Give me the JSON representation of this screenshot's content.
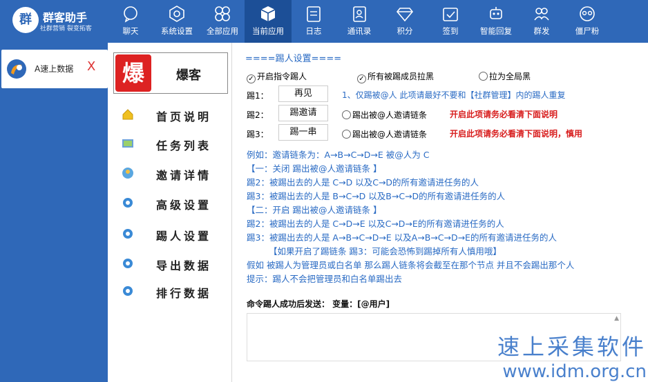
{
  "logo": {
    "title": "群客助手",
    "sub": "社群营销 裂变拓客",
    "badge": "群"
  },
  "nav": [
    {
      "label": "聊天",
      "icon": "chat-icon"
    },
    {
      "label": "系统设置",
      "icon": "gear-hex-icon"
    },
    {
      "label": "全部应用",
      "icon": "grid-apps-icon"
    },
    {
      "label": "当前应用",
      "icon": "cube-icon"
    },
    {
      "label": "日志",
      "icon": "log-icon"
    },
    {
      "label": "通讯录",
      "icon": "contacts-icon"
    },
    {
      "label": "积分",
      "icon": "diamond-icon"
    },
    {
      "label": "签到",
      "icon": "checkin-icon"
    },
    {
      "label": "智能回复",
      "icon": "robot-icon"
    },
    {
      "label": "群发",
      "icon": "group-send-icon"
    },
    {
      "label": "僵尸粉",
      "icon": "zombie-icon"
    }
  ],
  "account": {
    "name": "A速上数据",
    "close": "X"
  },
  "app": {
    "name": "爆客",
    "icon_text": "爆"
  },
  "menu": [
    {
      "label": "首页说明",
      "icon": "home-icon"
    },
    {
      "label": "任务列表",
      "icon": "task-list-icon"
    },
    {
      "label": "邀请详情",
      "icon": "invite-icon"
    },
    {
      "label": "高级设置",
      "icon": "gear-icon"
    },
    {
      "label": "踢人设置",
      "icon": "gear-icon"
    },
    {
      "label": "导出数据",
      "icon": "gear-icon"
    },
    {
      "label": "排行数据",
      "icon": "gear-icon"
    }
  ],
  "content": {
    "section_title": "====踢人设置====",
    "opt1": "开启指令踢人",
    "opt2": "所有被踢成员拉黑",
    "opt3": "拉为全局黑",
    "kick1_label": "踢1：",
    "kick1_btn": "再见",
    "kick1_note": "1、仅踢被@人  此项请最好不要和【社群管理】内的踢人重复",
    "kick2_label": "踢2：",
    "kick2_btn": "踢邀请",
    "kick2_opt": "踢出被@人邀请链条",
    "kick2_warn": "开启此项请务必看清下面说明",
    "kick3_label": "踢3：",
    "kick3_btn": "踢一串",
    "kick3_opt": "踢出被@人邀请链条",
    "kick3_warn": "开启此项请务必看清下面说明，慎用",
    "example": [
      "例如：邀请链条为：A→B→C→D→E  被@人为 C",
      "【一：关闭 踢出被@人邀请链条 】",
      "踢2：被踢出去的人是 C→D     以及C→D的所有邀请进任务的人",
      "踢3：被踢出去的人是 B→C→D     以及B→C→D的所有邀请进任务的人",
      "【二：开启 踢出被@人邀请链条 】",
      "踢2：被踢出去的人是 C→D→E     以及C→D→E的所有邀请进任务的人",
      "踢3：被踢出去的人是 A→B→C→D→E     以及A→B→C→D→E的所有邀请进任务的人",
      "【如果开启了踢链条 踢3：可能会恐怖到踢掉所有人慎用哦】",
      "假如 被踢人为管理员或白名单 那么踢人链条将会截至在那个节点 并且不会踢出那个人",
      "提示：踢人不会把管理员和白名单踢出去"
    ],
    "msg_label": "命令踢人成功后发送：  变量：[@用户]"
  },
  "watermark": {
    "line1": "速上采集软件",
    "line2": "www.idm.org.cn"
  }
}
